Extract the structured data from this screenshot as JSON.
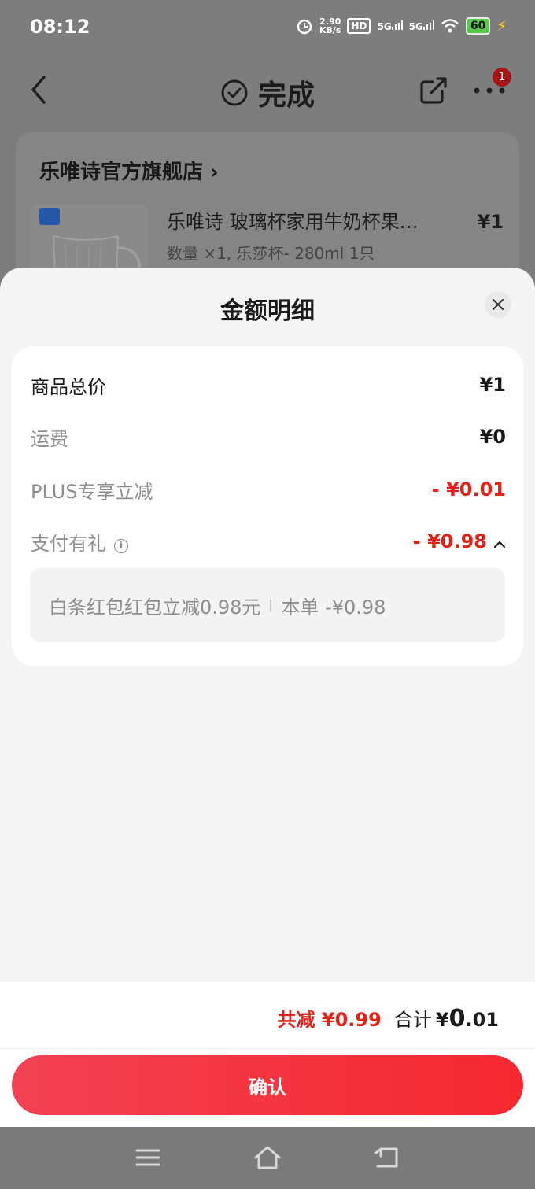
{
  "status_bar": {
    "time": "08:12",
    "net_speed_value": "2.90",
    "net_speed_unit": "KB/s",
    "hd_label": "HD",
    "sim1_label": "5G",
    "sim2_label": "5G",
    "battery": "60"
  },
  "nav": {
    "title": "完成",
    "badge_count": "1",
    "icons": [
      "back-icon",
      "check-circle-icon",
      "share-icon",
      "more-icon"
    ]
  },
  "order": {
    "shop_name": "乐唯诗官方旗舰店 ›",
    "product_title": "乐唯诗 玻璃杯家用牛奶杯果…",
    "product_spec": "数量 ×1, 乐莎杯- 280ml 1只",
    "product_price": "¥1"
  },
  "sheet": {
    "title": "金额明细",
    "rows": [
      {
        "label": "商品总价",
        "value": "¥1"
      },
      {
        "label": "运费",
        "value": "¥0"
      },
      {
        "label": "PLUS专享立减",
        "value": "- ¥0.01"
      },
      {
        "label": "支付有礼",
        "value": "- ¥0.98"
      }
    ],
    "sub_detail": {
      "name": "白条红包红包立减0.98元",
      "amount": "本单 -¥0.98"
    },
    "footer": {
      "discount_total": "共减 ¥0.99",
      "sum_label": "合计",
      "sum_currency": "¥",
      "sum_int": "0",
      "sum_dec": ".01",
      "confirm_label": "确认"
    }
  },
  "colors": {
    "accent_red": "#e2231a",
    "button_gradient_start": "#f34153",
    "button_gradient_end": "#f5282f"
  }
}
